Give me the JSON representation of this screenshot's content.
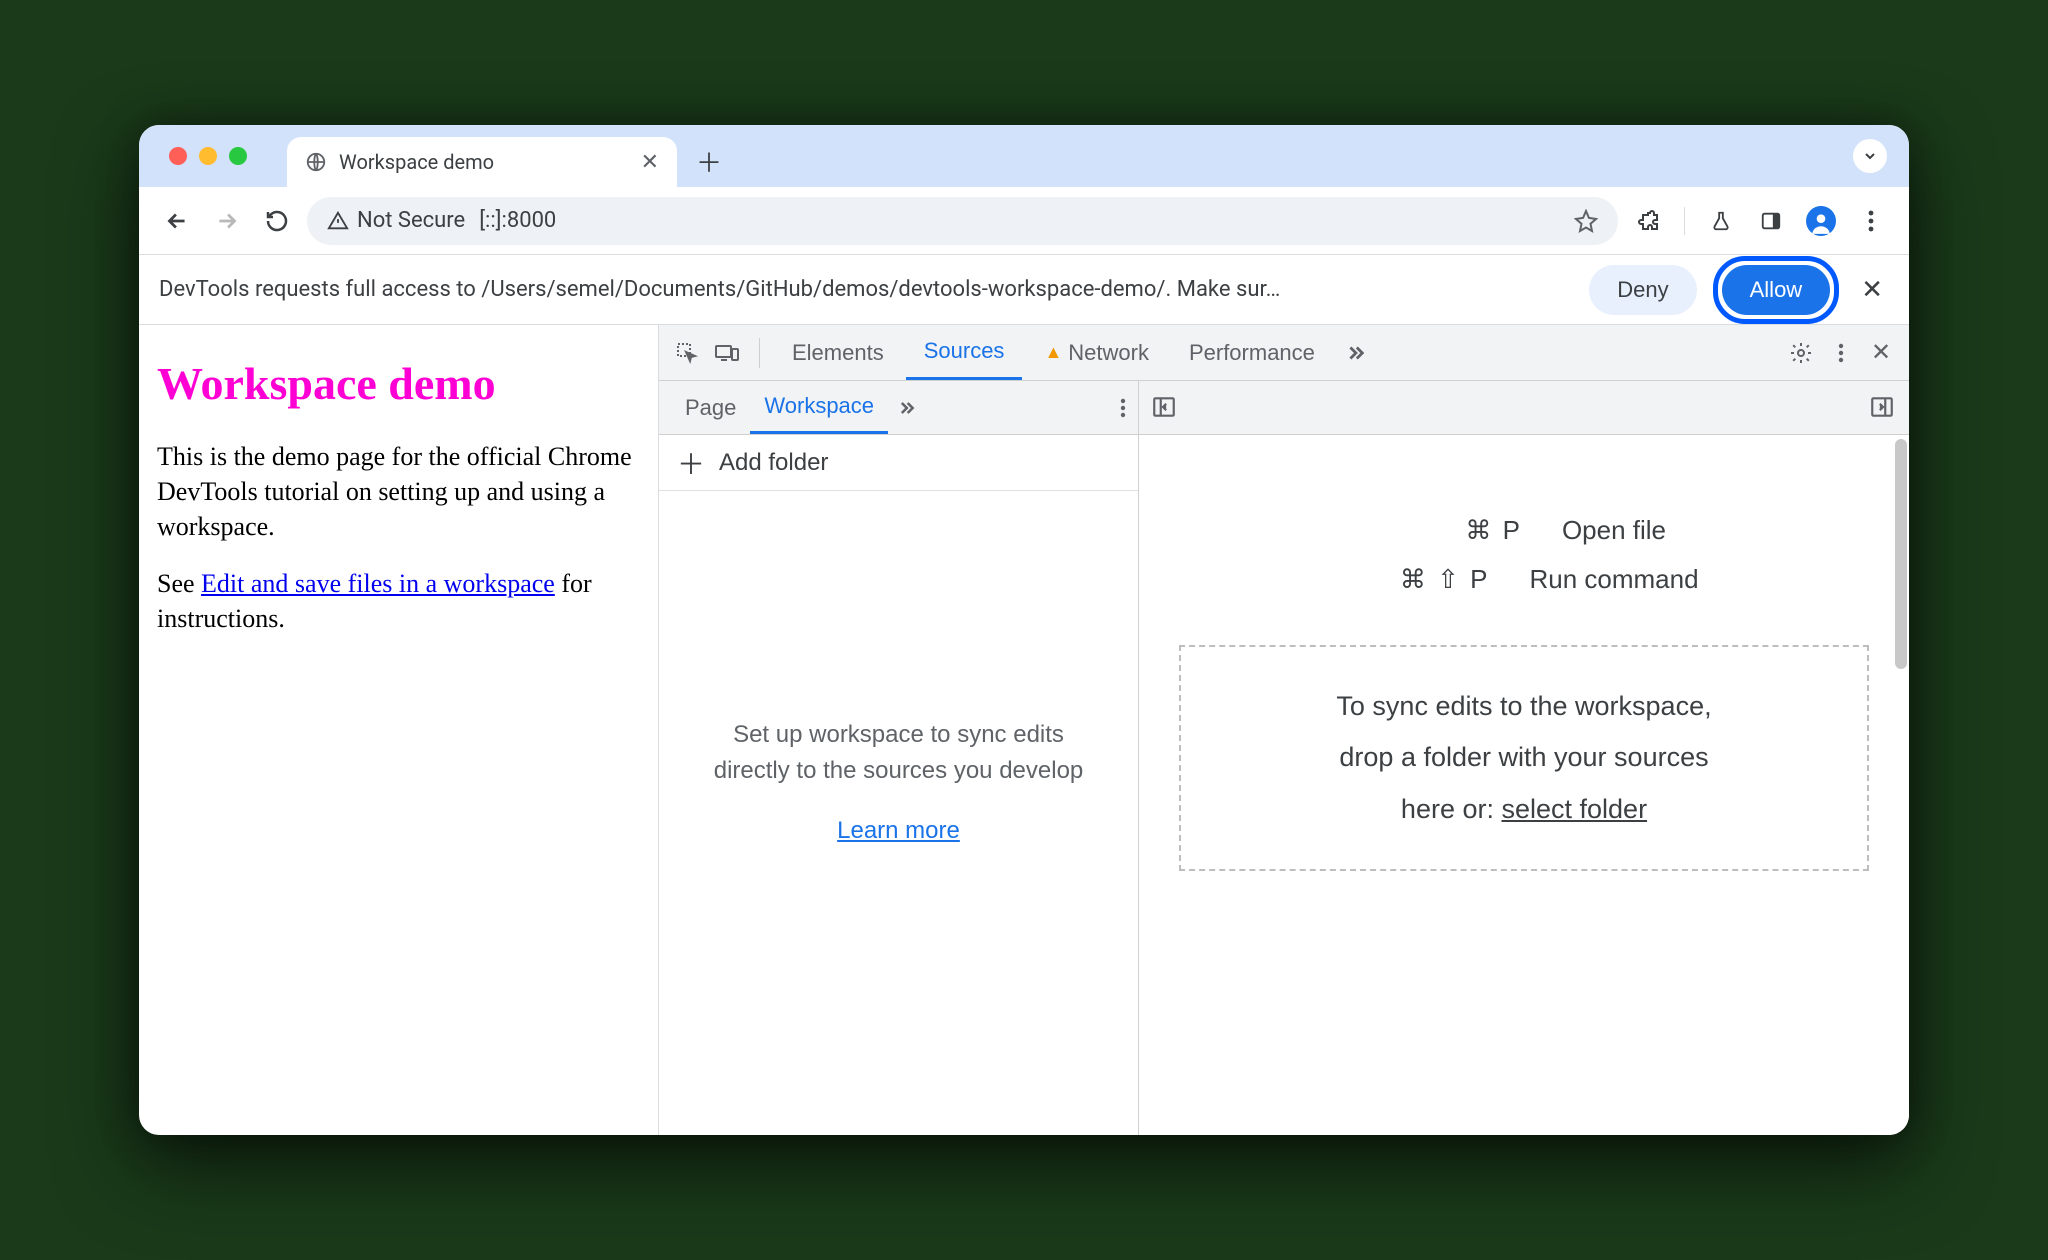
{
  "browser": {
    "tab_title": "Workspace demo",
    "security_label": "Not Secure",
    "url": "[::]:8000"
  },
  "infobar": {
    "message": "DevTools requests full access to /Users/semel/Documents/GitHub/demos/devtools-workspace-demo/. Make sur…",
    "deny": "Deny",
    "allow": "Allow"
  },
  "page": {
    "heading": "Workspace demo",
    "para1": "This is the demo page for the official Chrome DevTools tutorial on setting up and using a workspace.",
    "para2_pre": "See ",
    "para2_link": "Edit and save files in a workspace",
    "para2_post": " for instructions."
  },
  "devtools": {
    "tabs": {
      "elements": "Elements",
      "sources": "Sources",
      "network": "Network",
      "performance": "Performance"
    },
    "left_tabs": {
      "page": "Page",
      "workspace": "Workspace"
    },
    "add_folder": "Add folder",
    "workspace_hint": "Set up workspace to sync edits directly to the sources you develop",
    "learn_more": "Learn more",
    "shortcuts": {
      "open_file_keys": "⌘  P",
      "open_file_label": "Open file",
      "run_cmd_keys": "⌘  ⇧  P",
      "run_cmd_label": "Run command"
    },
    "dropzone": {
      "line1": "To sync edits to the workspace,",
      "line2": "drop a folder with your sources",
      "line3_pre": "here or: ",
      "select_folder": "select folder"
    }
  }
}
